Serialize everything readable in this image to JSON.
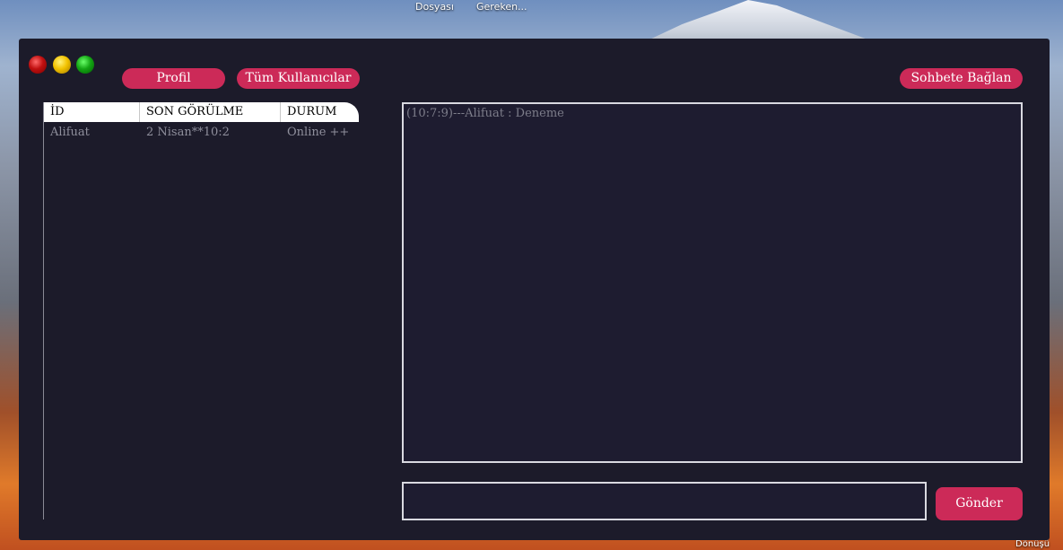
{
  "desktop": {
    "icons": [
      {
        "label": "Dosyası"
      },
      {
        "label": "Gereken..."
      }
    ],
    "bottom_icon_label": "Geri Dönüşü"
  },
  "window": {
    "controls": {
      "close": "close-dot",
      "minimize": "minimize-dot",
      "maximize": "maximize-dot"
    },
    "buttons": {
      "profil": "Profil",
      "users": "Tüm Kullanıcılar",
      "connect": "Sohbete Bağlan",
      "send": "Gönder"
    },
    "users_table": {
      "columns": [
        "İD",
        "SON GÖRÜLME",
        "DURUM"
      ],
      "rows": [
        {
          "id": "Alifuat",
          "last_seen": "2 Nisan**10:2",
          "status": "Online ++"
        }
      ]
    },
    "chat": {
      "lines": [
        "(10:7:9)---Alifuat : Deneme"
      ]
    },
    "message_input": {
      "value": "",
      "placeholder": ""
    }
  },
  "colors": {
    "window_bg": "#1c1b2a",
    "accent": "#cc2a58",
    "muted_text": "#8f8f9c"
  }
}
